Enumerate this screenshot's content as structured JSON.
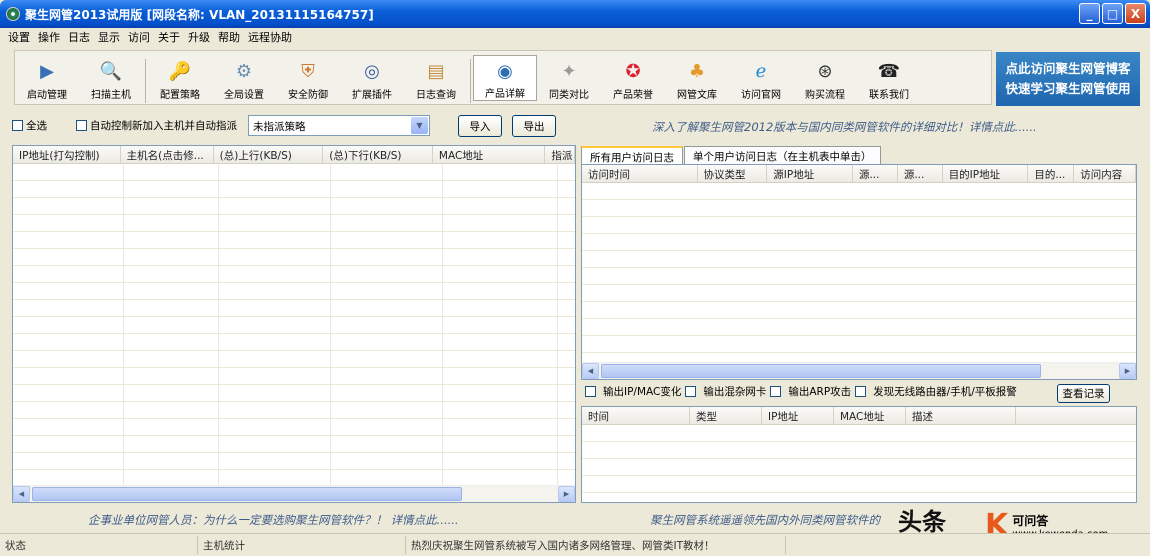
{
  "window": {
    "title": "聚生网管2013试用版 [网段名称: VLAN_20131115164757]",
    "min": "_",
    "max": "□",
    "close": "X"
  },
  "menu": [
    "设置",
    "操作",
    "日志",
    "显示",
    "访问",
    "关于",
    "升级",
    "帮助",
    "远程协助"
  ],
  "toolbar": [
    {
      "label": "启动管理",
      "icon": "play-icon",
      "glyph": "▶",
      "color": "#3a6fb5",
      "group": 1
    },
    {
      "label": "扫描主机",
      "icon": "magnifier-icon",
      "glyph": "🔍",
      "color": "#555",
      "group": 1
    },
    {
      "label": "配置策略",
      "icon": "key-icon",
      "glyph": "🔑",
      "color": "#b08b2e",
      "group": 2
    },
    {
      "label": "全局设置",
      "icon": "gear-icon",
      "glyph": "⚙",
      "color": "#6a8fb5",
      "group": 2
    },
    {
      "label": "安全防御",
      "icon": "shield-icon",
      "glyph": "⛨",
      "color": "#c73",
      "group": 2
    },
    {
      "label": "扩展插件",
      "icon": "plugin-icon",
      "glyph": "◎",
      "color": "#3b5e9e",
      "group": 2
    },
    {
      "label": "日志查询",
      "icon": "log-icon",
      "glyph": "▤",
      "color": "#c38b3a",
      "group": 2
    },
    {
      "label": "产品详解",
      "icon": "compass-icon",
      "glyph": "◉",
      "color": "#2f6fb1",
      "group": 3,
      "active": true
    },
    {
      "label": "同类对比",
      "icon": "medal-icon",
      "glyph": "✦",
      "color": "#9a9a9a",
      "group": 3
    },
    {
      "label": "产品荣誉",
      "icon": "award-icon",
      "glyph": "✪",
      "color": "#d23",
      "group": 3
    },
    {
      "label": "网管文库",
      "icon": "people-icon",
      "glyph": "♣",
      "color": "#e39a2a",
      "group": 3
    },
    {
      "label": "访问官网",
      "icon": "ie-icon",
      "glyph": "ℯ",
      "color": "#1f8ad6",
      "group": 3
    },
    {
      "label": "购买流程",
      "icon": "cart-icon",
      "glyph": "⊛",
      "color": "#333",
      "group": 3
    },
    {
      "label": "联系我们",
      "icon": "phone-icon",
      "glyph": "☎",
      "color": "#222",
      "group": 3
    }
  ],
  "ad": {
    "line1": "点此访问聚生网管博客",
    "line2": "快速学习聚生网管使用"
  },
  "options": {
    "select_all": "全选",
    "auto_control": "自动控制新加入主机并自动指派",
    "policy": "未指派策略",
    "import": "导入",
    "export": "导出"
  },
  "link_top": "深入了解聚生网管2012版本与国内同类网管软件的详细对比！详情点此......",
  "host_table": {
    "headers": [
      "IP地址(打勾控制)",
      "主机名(点击修...",
      "(总)上行(KB/S)",
      "(总)下行(KB/S)",
      "MAC地址",
      "指派"
    ]
  },
  "tabs": [
    "所有用户访问日志",
    "单个用户访问日志（在主机表中单击）"
  ],
  "log_table": {
    "headers": [
      "访问时间",
      "协议类型",
      "源IP地址",
      "源...",
      "源...",
      "目的IP地址",
      "目的...",
      "访问内容"
    ]
  },
  "alerts": {
    "items": [
      "输出IP/MAC变化",
      "输出混杂网卡",
      "输出ARP攻击",
      "发现无线路由器/手机/平板报警"
    ],
    "view": "查看记录"
  },
  "event_table": {
    "headers": [
      "时间",
      "类型",
      "IP地址",
      "MAC地址",
      "描述"
    ]
  },
  "link_bottom_left": "企事业单位网管人员：为什么一定要选购聚生网管软件？！ 详情点此......",
  "link_bottom_right": "聚生网管系统遥遥领先国内外同类网管软件的",
  "status": {
    "state": "状态",
    "hosts": "主机统计",
    "news": "热烈庆祝聚生网管系统被写入国内诸多网络管理、网管类IT教材！"
  },
  "watermark": {
    "k": "K",
    "name": "可问答",
    "url": "www.kewenda.com",
    "stamp": "头条"
  }
}
